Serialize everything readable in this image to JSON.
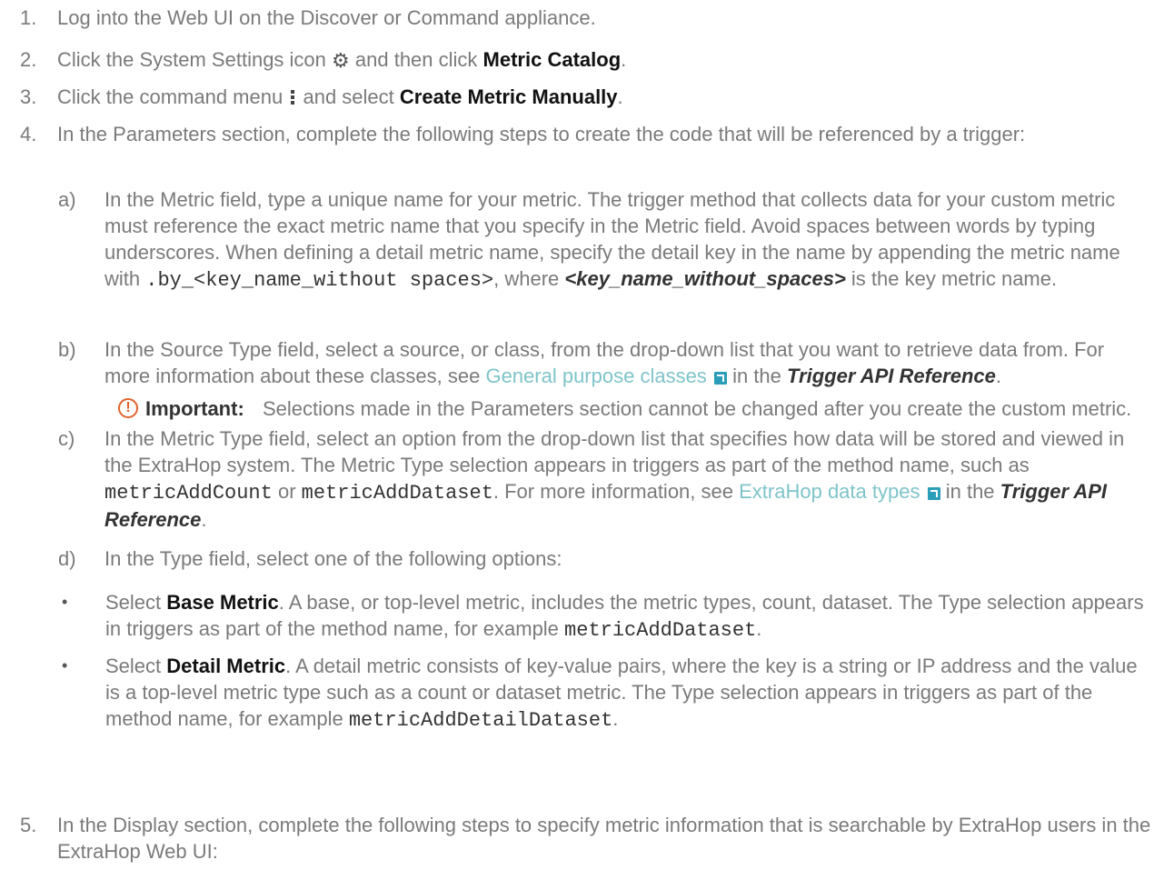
{
  "steps": [
    {
      "num": "1.",
      "text": "Log into the Web UI on the Discover or Command appliance."
    },
    {
      "num": "2.",
      "pre": "Click the System Settings icon",
      "mid": "and then click",
      "bold": "Metric Catalog",
      "post": "."
    },
    {
      "num": "3.",
      "pre": "Click the command menu",
      "mid": "and select",
      "bold": "Create Metric Manually",
      "post": "."
    },
    {
      "num": "4.",
      "text": "In the Parameters section, complete the following steps to create the code that will be referenced by a trigger:"
    },
    {
      "num": "5.",
      "text": "In the Display section, complete the following steps to specify metric information that is searchable by ExtraHop users in the ExtraHop Web UI:"
    }
  ],
  "substeps": {
    "a": {
      "label": "a)",
      "text1": "In the Metric field, type a unique name for your metric. The trigger method that collects data for your custom metric must reference the exact metric name that you specify in the Metric field. Avoid spaces between words by typing underscores. When defining a detail metric name, specify the detail key in the name by appending the metric name with",
      "code": ".by_<key_name_without spaces>",
      "text2": ", where",
      "em": "<key_name_without_spaces>",
      "text3": "is the key metric name."
    },
    "b": {
      "label": "b)",
      "text1": "In the Source Type field, select a source, or class, from the drop-down list that you want to retrieve data from. For more information about these classes, see",
      "link": "General purpose classes",
      "text2": "in the",
      "em": "Trigger API Reference",
      "text3": "."
    },
    "c": {
      "label": "c)",
      "text1": "In the Metric Type field, select an option from the drop-down list that specifies how data will be stored and viewed in the ExtraHop system. The Metric Type selection appears in triggers as part of the method name, such as",
      "code1": "metricAddCount",
      "or": "or",
      "code2": "metricAddDataset",
      "text2": ". For more information, see",
      "link": "ExtraHop data types",
      "text3": "in the",
      "em": "Trigger API Reference",
      "text4": "."
    },
    "d": {
      "label": "d)",
      "text": "In the Type field, select one of the following options:"
    }
  },
  "bullets": [
    {
      "pre": "Select",
      "bold": "Base Metric",
      "text": ". A base, or top-level metric, includes the metric types, count, dataset. The Type selection appears in triggers as part of the method name, for example",
      "code": "metricAddDataset",
      "post": "."
    },
    {
      "pre": "Select",
      "bold": "Detail Metric",
      "text": ". A detail metric consists of key-value pairs, where the key is a string or IP address and the value is a top-level metric type such as a count or dataset metric. The Type selection appears in triggers as part of the method name, for example",
      "code": "metricAddDetailDataset",
      "post": "."
    }
  ],
  "important": {
    "label": "Important:",
    "text": "Selections made in the Parameters section cannot be changed after you create the custom metric."
  },
  "icons": {
    "settings": "gear-icon",
    "menu": "command-menu-icon",
    "external": "external-link-icon",
    "important": "important-icon"
  },
  "colors": {
    "text": "#7a7a7a",
    "bold": "#111111",
    "link": "#7fc4c9",
    "important": "#e0642c"
  }
}
